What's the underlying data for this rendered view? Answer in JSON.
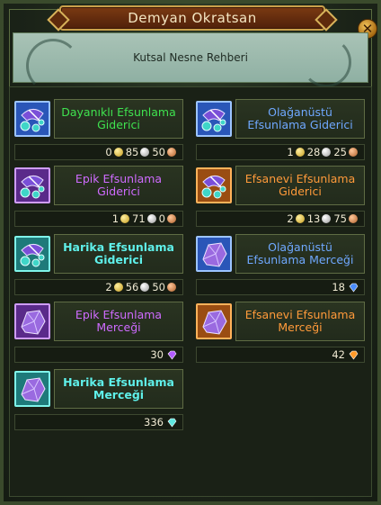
{
  "window": {
    "title": "Demyan Okratsan",
    "close_label": "✕"
  },
  "banner": {
    "text": "Kutsal Nesne Rehberi"
  },
  "items": [
    {
      "name": "Dayanıklı Efsunlama Giderici",
      "color_class": "c-green",
      "icon": "remover-icon",
      "tier": "tier-rare",
      "price": {
        "gold": "0",
        "silver": "85",
        "copper": "50"
      }
    },
    {
      "name": "Olağanüstü Efsunlama Giderici",
      "color_class": "c-blue",
      "icon": "remover-icon",
      "tier": "tier-rare",
      "price": {
        "gold": "1",
        "silver": "28",
        "copper": "25"
      }
    },
    {
      "name": "Epik Efsunlama Giderici",
      "color_class": "c-purple",
      "icon": "remover-icon",
      "tier": "tier-epic",
      "price": {
        "gold": "1",
        "silver": "71",
        "copper": "0"
      }
    },
    {
      "name": "Efsanevi Efsunlama Giderici",
      "color_class": "c-orange",
      "icon": "remover-icon",
      "tier": "tier-legend",
      "price": {
        "gold": "2",
        "silver": "13",
        "copper": "75"
      }
    },
    {
      "name": "Harika Efsunlama Giderici",
      "color_class": "c-cyan",
      "icon": "remover-icon",
      "tier": "tier-mythic",
      "price": {
        "gold": "2",
        "silver": "56",
        "copper": "50"
      }
    },
    {
      "name": "Olağanüstü Efsunlama Merceği",
      "color_class": "c-blue",
      "icon": "crystal-lens-icon",
      "tier": "tier-rare",
      "price": {
        "gems": "18",
        "gem_color": "#4a8cff"
      }
    },
    {
      "name": "Epik Efsunlama Merceği",
      "color_class": "c-purple",
      "icon": "crystal-lens-icon",
      "tier": "tier-epic",
      "price": {
        "gems": "30",
        "gem_color": "#b25cff"
      }
    },
    {
      "name": "Efsanevi Efsunlama Merceği",
      "color_class": "c-orange",
      "icon": "crystal-lens-icon",
      "tier": "tier-legend",
      "price": {
        "gems": "42",
        "gem_color": "#ff9a2a"
      }
    },
    {
      "name": "Harika Efsunlama Merceği",
      "color_class": "c-cyan",
      "icon": "crystal-lens-icon",
      "tier": "tier-mythic",
      "price": {
        "gems": "336",
        "gem_color": "#5fe8e0"
      }
    }
  ]
}
